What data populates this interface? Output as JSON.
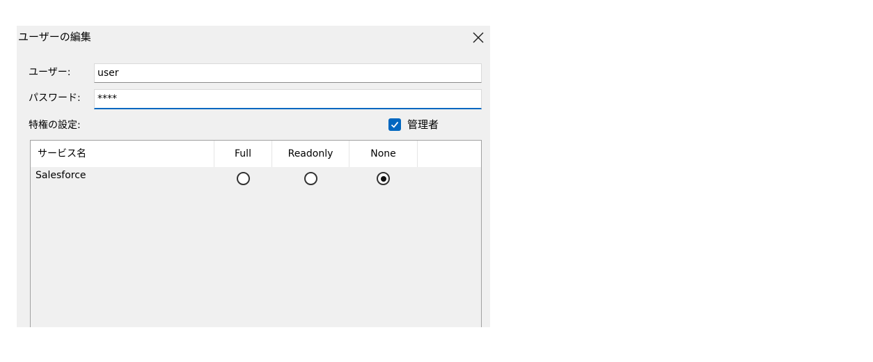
{
  "dialog": {
    "title": "ユーザーの編集"
  },
  "form": {
    "user_label": "ユーザー:",
    "user_value": "user",
    "password_label": "パスワード:",
    "password_value": "****",
    "privileges_label": "特権の設定:",
    "admin_label": "管理者",
    "admin_checked": true
  },
  "table": {
    "columns": [
      "サービス名",
      "Full",
      "Readonly",
      "None"
    ],
    "rows": [
      {
        "service": "Salesforce",
        "selected": "None"
      }
    ]
  },
  "colors": {
    "accent": "#0067c0",
    "dialog_bg": "#f0f0f0"
  }
}
